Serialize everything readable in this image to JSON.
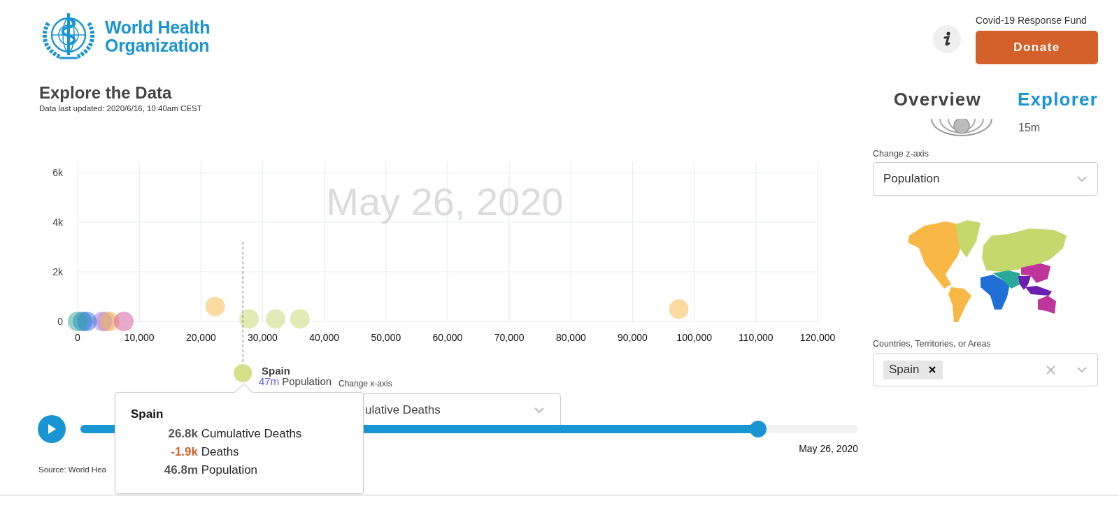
{
  "header": {
    "logo_text": "World Health Organization",
    "fund_label": "Covid-19 Response Fund",
    "donate_button": "Donate"
  },
  "page_title": "Explore the Data",
  "updated": "Data last updated: 2020/6/16, 10:40am CEST",
  "tabs": [
    {
      "label": "Overview",
      "selected": false
    },
    {
      "label": "Explorer",
      "selected": true
    }
  ],
  "chart": {
    "watermark_date": "May 26, 2020",
    "chart_data": {
      "type": "scatter",
      "grid": true,
      "x": [
        0,
        800,
        1500,
        4000,
        4600,
        5200,
        7500,
        22300,
        27800,
        32100,
        36050,
        97500
      ],
      "xlim": [
        0,
        120000
      ],
      "ylim": [
        0,
        6450
      ],
      "xticks": [
        {
          "value": 0,
          "label": "0"
        },
        {
          "value": 10000,
          "label": "10,000"
        },
        {
          "value": 20000,
          "label": "20,000"
        },
        {
          "value": 30000,
          "label": "30,000"
        },
        {
          "value": 40000,
          "label": "40,000"
        },
        {
          "value": 50000,
          "label": "50,000"
        },
        {
          "value": 60000,
          "label": "60,000"
        },
        {
          "value": 70000,
          "label": "70,000"
        },
        {
          "value": 80000,
          "label": "80,000"
        },
        {
          "value": 90000,
          "label": "90,000"
        },
        {
          "value": 100000,
          "label": "100,000"
        },
        {
          "value": 110000,
          "label": "110,000"
        },
        {
          "value": 120000,
          "label": "120,000"
        }
      ],
      "yticks": [
        {
          "value": 0,
          "label": "0"
        },
        {
          "value": 2000,
          "label": "2k"
        },
        {
          "value": 4000,
          "label": "4k"
        },
        {
          "value": 6000,
          "label": "6k"
        }
      ],
      "ref_lines": [
        {
          "axis": "x",
          "value": 26800
        }
      ],
      "series": [
        {
          "color": "#d98bc9",
          "values": [
            null,
            null,
            null,
            null,
            0,
            null,
            null,
            null,
            null,
            null,
            null,
            null
          ]
        },
        {
          "color": "#a57fd6",
          "values": [
            null,
            null,
            null,
            0,
            null,
            null,
            null,
            null,
            null,
            null,
            null,
            null
          ]
        },
        {
          "color": "#2a6fd6",
          "values": [
            null,
            0,
            0,
            null,
            null,
            null,
            null,
            null,
            null,
            null,
            null,
            null
          ]
        },
        {
          "color": "#2aa89a",
          "values": [
            0,
            null,
            null,
            null,
            null,
            null,
            null,
            null,
            null,
            null,
            null,
            null
          ]
        },
        {
          "color": "#f9b845",
          "values": [
            null,
            null,
            null,
            null,
            null,
            0,
            null,
            600,
            null,
            null,
            null,
            500
          ]
        },
        {
          "color": "#c5d86d",
          "values": [
            null,
            null,
            null,
            null,
            null,
            null,
            null,
            null,
            100,
            100,
            100,
            null
          ]
        },
        {
          "color": "#d0559a",
          "values": [
            null,
            null,
            null,
            null,
            null,
            null,
            0,
            null,
            null,
            null,
            null,
            null
          ]
        }
      ]
    },
    "highlight": {
      "name": "Spain",
      "value": "47m",
      "value_label": "Population"
    }
  },
  "x_axis_select": {
    "label": "Change x-axis",
    "value": "ulative Deaths"
  },
  "tooltip": {
    "title": "Spain",
    "rows": [
      {
        "text": "**26.8k** Cumulative Deaths",
        "kind": "neutral"
      },
      {
        "text": "**-1.9k** Deaths",
        "kind": "negative"
      },
      {
        "text": "**46.8m** Population",
        "kind": "neutral"
      }
    ]
  },
  "timeline": {
    "level": 0.871,
    "date": "May 26, 2020"
  },
  "source": "Source: World Hea",
  "sidebar": {
    "legend_value": "15m",
    "z_axis_select": {
      "label": "Change z-axis",
      "value": "Population"
    },
    "countries": {
      "label": "Countries, Territories, or Areas",
      "chips": [
        {
          "label": "Spain"
        }
      ]
    }
  }
}
